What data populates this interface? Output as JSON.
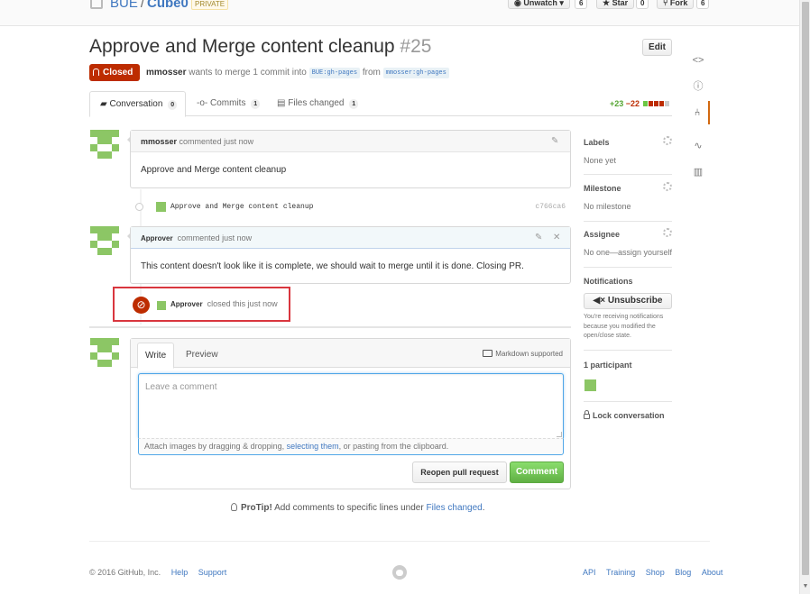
{
  "repo": {
    "owner": "BUE",
    "separator": "/",
    "name": "Cube0",
    "visibility": "PRIVATE",
    "watch_label": "Unwatch",
    "watch_count": "6",
    "star_label": "Star",
    "star_count": "0",
    "fork_label": "Fork",
    "fork_count": "6"
  },
  "pr": {
    "title": "Approve and Merge content cleanup",
    "number": "#25",
    "edit_label": "Edit",
    "state": "Closed",
    "author": "mmosser",
    "meta_text": "wants to merge 1 commit into",
    "base_branch": "BUE:gh-pages",
    "from_text": "from",
    "head_branch": "mmosser:gh-pages"
  },
  "tabs": [
    {
      "label": "Conversation",
      "count": "0"
    },
    {
      "label": "Commits",
      "count": "1"
    },
    {
      "label": "Files changed",
      "count": "1"
    }
  ],
  "diffstat": {
    "additions": "+23",
    "deletions": "−22"
  },
  "comments": [
    {
      "author": "mmosser",
      "action": "commented just now",
      "body": "Approve and Merge content cleanup"
    },
    {
      "author": "Approver",
      "action": "commented just now",
      "body": "This content doesn't look like it is complete, we should wait to merge until it is done. Closing PR."
    }
  ],
  "commit": {
    "message": "Approve and Merge content cleanup",
    "sha": "c766ca6"
  },
  "closed_event": {
    "actor": "Approver",
    "text": "closed this just now"
  },
  "form": {
    "write_tab": "Write",
    "preview_tab": "Preview",
    "markdown_note": "Markdown supported",
    "placeholder": "Leave a comment",
    "attach_text_1": "Attach images by dragging & dropping,",
    "attach_link": "selecting them",
    "attach_text_2": ", or pasting from the clipboard.",
    "reopen_label": "Reopen pull request",
    "comment_label": "Comment"
  },
  "protip": {
    "label": "ProTip!",
    "text": "Add comments to specific lines under",
    "link": "Files changed",
    "end": "."
  },
  "sidebar": {
    "labels_heading": "Labels",
    "labels_value": "None yet",
    "milestone_heading": "Milestone",
    "milestone_value": "No milestone",
    "assignee_heading": "Assignee",
    "assignee_value": "No one—assign yourself",
    "notifications_heading": "Notifications",
    "unsubscribe_label": "Unsubscribe",
    "notifications_note": "You're receiving notifications because you modified the open/close state.",
    "participants_heading": "1 participant",
    "lock_label": "Lock conversation"
  },
  "footer": {
    "copyright": "© 2016 GitHub, Inc.",
    "left_links": [
      "Help",
      "Support"
    ],
    "right_links": [
      "API",
      "Training",
      "Shop",
      "Blog",
      "About"
    ]
  },
  "colors": {
    "closed": "#bd2c00",
    "accent": "#4078c0",
    "success": "#6cc644",
    "avatar": "#8cc665"
  }
}
